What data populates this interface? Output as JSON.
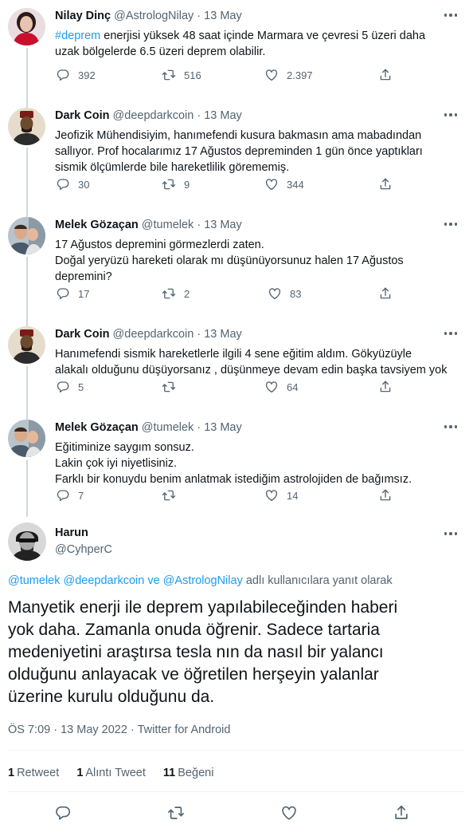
{
  "tweets": [
    {
      "name": "Nilay Dinç",
      "handle": "@AstrologNilay",
      "time": "13 May",
      "lines": [
        {
          "tag": "#deprem",
          "rest": " enerjisi yüksek 48 saat içinde Marmara ve çevresi 5 üzeri daha"
        },
        {
          "tag": "",
          "rest": "uzak bölgelerde 6.5 üzeri deprem olabilir."
        }
      ],
      "replies": "392",
      "retweets": "516",
      "likes": "2.397"
    },
    {
      "name": "Dark Coin",
      "handle": "@deepdarkcoin",
      "time": "13 May",
      "lines": [
        {
          "tag": "",
          "rest": "Jeofizik Mühendisiyim, hanımefendi kusura bakmasın ama mabadından"
        },
        {
          "tag": "",
          "rest": "sallıyor. Prof hocalarımız 17 Ağustos depreminden 1 gün önce yaptıkları"
        },
        {
          "tag": "",
          "rest": "sismik ölçümlerde bile hareketlilik görememiş."
        }
      ],
      "replies": "30",
      "retweets": "9",
      "likes": "344"
    },
    {
      "name": "Melek Gözaçan",
      "handle": "@tumelek",
      "time": "13 May",
      "lines": [
        {
          "tag": "",
          "rest": "17 Ağustos depremini görmezlerdi zaten."
        },
        {
          "tag": "",
          "rest": "Doğal yeryüzü hareketi olarak mı düşünüyorsunuz halen 17 Ağustos"
        },
        {
          "tag": "",
          "rest": "depremini?"
        }
      ],
      "replies": "17",
      "retweets": "2",
      "likes": "83"
    },
    {
      "name": "Dark Coin",
      "handle": "@deepdarkcoin",
      "time": "13 May",
      "lines": [
        {
          "tag": "",
          "rest": "Hanımefendi sismik hareketlerle ilgili 4 sene eğitim aldım. Gökyüzüyle"
        },
        {
          "tag": "",
          "rest": "alakalı olduğunu düşüyorsanız , düşünmeye devam edin başka tavsiyem yok"
        }
      ],
      "replies": "5",
      "retweets": "",
      "likes": "64"
    },
    {
      "name": "Melek Gözaçan",
      "handle": "@tumelek",
      "time": "13 May",
      "lines": [
        {
          "tag": "",
          "rest": "Eğitiminize saygım sonsuz."
        },
        {
          "tag": "",
          "rest": "Lakin çok iyi niyetlisiniz."
        },
        {
          "tag": "",
          "rest": "Farklı bir konuydu benim anlatmak istediğim astrolojiden de bağımsız."
        }
      ],
      "replies": "7",
      "retweets": "",
      "likes": "14"
    }
  ],
  "main": {
    "name": "Harun",
    "handle": "@CyhperC",
    "reply_mentions": "@tumelek @deepdarkcoin ve @AstrologNilay",
    "reply_suffix": " adlı kullanıcılara yanıt olarak",
    "text_lines": [
      "Manyetik enerji ile deprem yapılabileceğinden haberi",
      "yok daha. Zamanla onuda öğrenir. Sadece tartaria",
      "medeniyetini araştırsa tesla nın da nasıl bir yalancı",
      "olduğunu anlayacak ve öğretilen herşeyin yalanlar",
      "üzerine kurulu olduğunu da."
    ],
    "time": "ÖS 7:09",
    "date": "13 May 2022",
    "source": "Twitter for Android",
    "retweets_count": "1",
    "retweets_label": "Retweet",
    "quotes_count": "1",
    "quotes_label": "Alıntı Tweet",
    "likes_count": "11",
    "likes_label": "Beğeni"
  },
  "colors": {
    "accent": "#1d9bf0",
    "secondary_text": "#536471",
    "primary_text": "#0f1419"
  },
  "icons": [
    "reply-icon",
    "retweet-icon",
    "like-icon",
    "share-icon",
    "more-icon"
  ]
}
